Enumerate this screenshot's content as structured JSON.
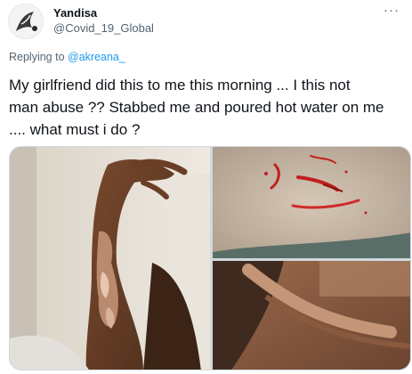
{
  "author": {
    "display_name": "Yandisa",
    "handle": "@Covid_19_Global",
    "avatar_icon": "sketch-avatar-icon"
  },
  "more_icon": "more-options-icon",
  "reply": {
    "prefix": "Replying to ",
    "mention": "@akreana_"
  },
  "tweet": {
    "lines": [
      "My girlfriend did this to me this morning ... I this not",
      "man abuse ?? Stabbed me and poured hot water on me",
      ".... what must i do ?"
    ]
  },
  "media": {
    "count": 3,
    "photos": [
      "photo-burned-arm",
      "photo-stab-wounds",
      "photo-torso-closeup"
    ]
  },
  "colors": {
    "link": "#1d9bf0",
    "secondary_text": "#536471",
    "primary_text": "#0f1419"
  }
}
